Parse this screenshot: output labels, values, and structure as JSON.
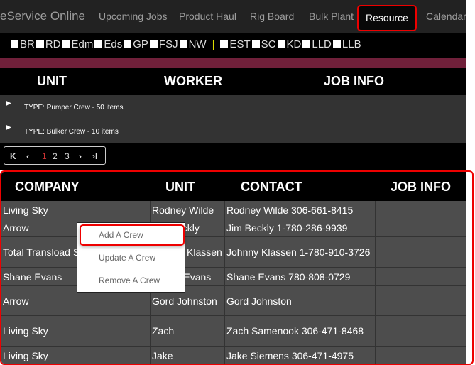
{
  "nav": {
    "brand": "eService Online",
    "items": [
      "Upcoming Jobs",
      "Product Haul",
      "Rig Board",
      "Bulk Plant"
    ],
    "active": "Resource",
    "last": "Calendar"
  },
  "filters": {
    "left": [
      "BR",
      "RD",
      "Edm",
      "Eds",
      "GP",
      "FSJ",
      "NW"
    ],
    "separator": "|",
    "right": [
      "EST",
      "SC",
      "KD",
      "LLD",
      "LLB"
    ]
  },
  "top_table": {
    "headers": [
      "UNIT",
      "WORKER",
      "JOB INFO"
    ],
    "groups": [
      "TYPE: Pumper Crew - 50 items",
      "TYPE: Bulker Crew - 10 items"
    ]
  },
  "pager": {
    "first": "K",
    "prev": "‹",
    "pages": [
      "1",
      "2",
      "3"
    ],
    "current": "1",
    "next": "›",
    "last": "›I"
  },
  "grid": {
    "headers": [
      "COMPANY",
      "UNIT",
      "CONTACT",
      "JOB INFO"
    ],
    "rows": [
      {
        "company": "Living Sky",
        "unit": "Rodney Wilde",
        "contact": "Rodney Wilde 306-661-8415",
        "job": ""
      },
      {
        "company": "Arrow",
        "unit": "Jim Beckly",
        "contact": "Jim Beckly 1-780-286-9939",
        "job": ""
      },
      {
        "company": "Total Transload Services",
        "unit": "Johnny Klassen",
        "contact": "Johnny Klassen 1-780-910-3726",
        "job": ""
      },
      {
        "company": "Shane Evans",
        "unit": "Shane Evans",
        "contact": "Shane Evans 780-808-0729",
        "job": ""
      },
      {
        "company": "Arrow",
        "unit": "Gord Johnston",
        "contact": "Gord Johnston",
        "job": ""
      },
      {
        "company": "Living Sky",
        "unit": "Zach",
        "contact": "Zach Samenook 306-471-8468",
        "job": ""
      },
      {
        "company": "Living Sky",
        "unit": "Jake",
        "contact": "Jake Siemens 306-471-4975",
        "job": ""
      }
    ]
  },
  "context_menu": [
    "Add A Crew",
    "Update A Crew",
    "Remove A Crew"
  ]
}
